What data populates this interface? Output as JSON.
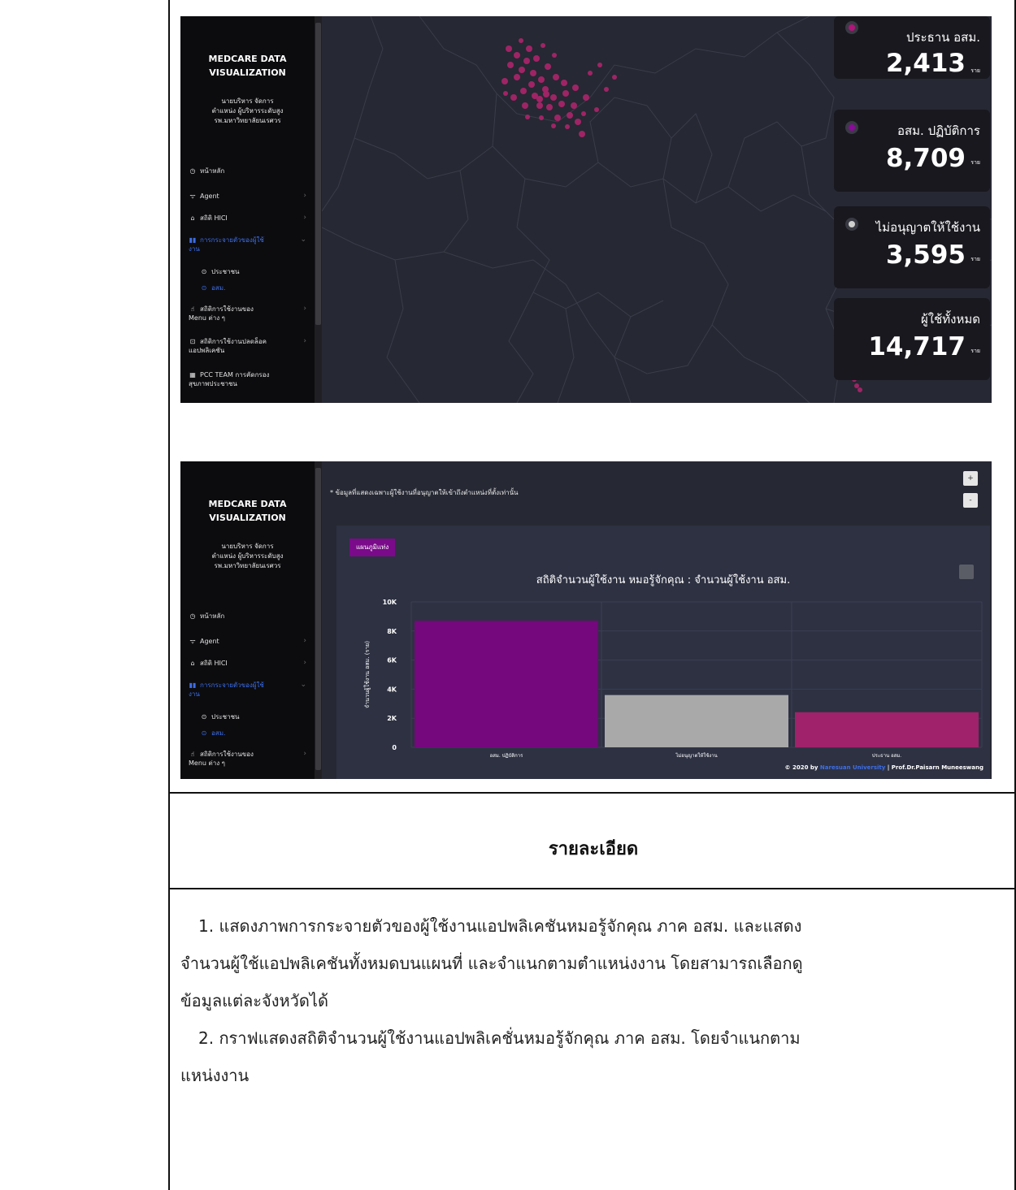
{
  "sidebar": {
    "brand_line1": "MEDCARE DATA",
    "brand_line2": "VISUALIZATION",
    "user_line1": "นายบริหาร จัดการ",
    "user_line2": "ตำแหน่ง ผู้บริหารระดับสูง",
    "user_line3": "รพ.มหาวิทยาลัยนเรศวร",
    "items": [
      {
        "label": "หน้าหลัก"
      },
      {
        "label": "Agent"
      },
      {
        "label": "สถิติ HICI"
      },
      {
        "label_a": "การกระจายตัวของผู้ใช้",
        "label_b": "งาน"
      },
      {
        "label": "ประชาชน"
      },
      {
        "label": "อสม."
      },
      {
        "label_a": "สถิติการใช้งานของ",
        "label_b": "Menu ต่าง ๆ"
      },
      {
        "label_a": "สถิติการใช้งานปลดล็อค",
        "label_b": "แอปพลิเคชัน"
      },
      {
        "label_a": "PCC TEAM การคัดกรอง",
        "label_b": "สุขภาพประชาชน"
      }
    ]
  },
  "stats": [
    {
      "label": "ประธาน อสม.",
      "value": "2,413",
      "unit": "ราย",
      "color": "#b0157a"
    },
    {
      "label": "อสม. ปฏิบัติการ",
      "value": "8,709",
      "unit": "ราย",
      "color": "#8a0a9a"
    },
    {
      "label": "ไม่อนุญาตให้ใช้งาน",
      "value": "3,595",
      "unit": "ราย",
      "color": "#cfcfcf"
    },
    {
      "label": "ผู้ใช้ทั้งหมด",
      "value": "14,717",
      "unit": "ราย",
      "color": ""
    }
  ],
  "chart_note": "* ข้อมูลที่แสดงเฉพาะผู้ใช้งานที่อนุญาตให้เข้าถึงตำแหน่งที่ตั้งเท่านั้น",
  "chart_tab": "แผนภูมิแท่ง",
  "zoom_in": "+",
  "zoom_out": "-",
  "footer": {
    "prefix": "© 2020 by ",
    "link": "Naresuan University",
    "suffix": " | Prof.Dr.Paisarn Muneeswang"
  },
  "chart_data": {
    "type": "bar",
    "title": "สถิติจำนวนผู้ใช้งาน หมอรู้จักคุณ : จำนวนผู้ใช้งาน อสม.",
    "ylabel": "จำนวนผู้ใช้งาน อสม. (ราย)",
    "xlabel": "",
    "categories": [
      "อสม. ปฏิบัติการ",
      "ไม่อนุญาตให้ใช้งาน",
      "ประธาน อสม."
    ],
    "values": [
      8709,
      3595,
      2413
    ],
    "colors": [
      "#74087c",
      "#a9a9a9",
      "#a0226a"
    ],
    "ylim": [
      0,
      10000
    ],
    "yticks": [
      "0",
      "2K",
      "4K",
      "6K",
      "8K",
      "10K"
    ],
    "grid": true
  },
  "detail_heading": "รายละเอียด",
  "detail_p1_l1": "1. แสดงภาพการกระจายตัวของผู้ใช้งานแอปพลิเคชันหมอรู้จักคุณ ภาค อสม. และแสดง",
  "detail_p1_l2": "จำนวนผู้ใช้แอปพลิเคชันทั้งหมดบนแผนที่ และจำแนกตามตำแหน่งงาน โดยสามารถเลือกดู",
  "detail_p1_l3": "ข้อมูลแต่ละจังหวัดได้",
  "detail_p2_l1": "2. กราฟแสดงสถิติจำนวนผู้ใช้งานแอปพลิเคชั่นหมอรู้จักคุณ ภาค อสม. โดยจำแนกตาม",
  "detail_p2_l2": "แหน่งงาน"
}
